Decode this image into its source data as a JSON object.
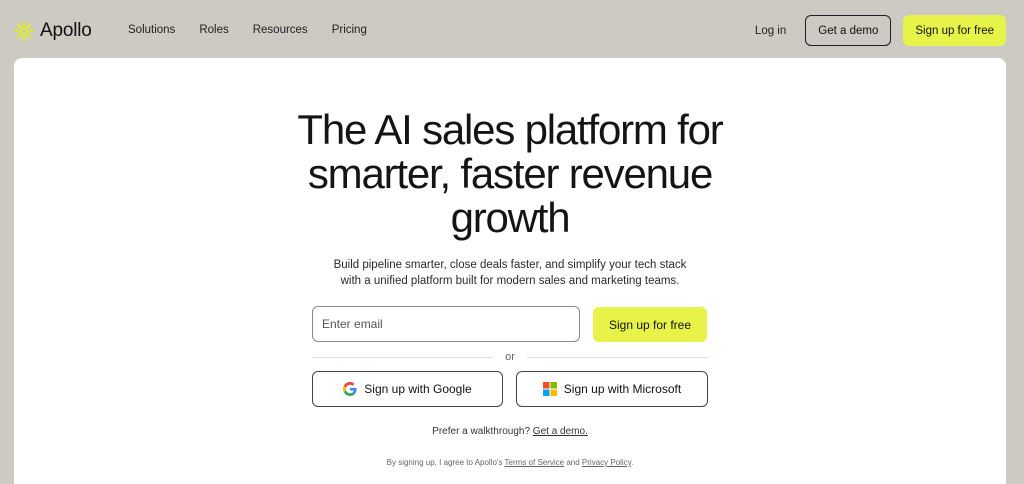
{
  "colors": {
    "page_background": "#cdc9c3",
    "card_background": "#ffffff",
    "accent_yellow": "#e8f34a",
    "logo_yellow": "#dfe93a",
    "text_primary": "#141414"
  },
  "nav": {
    "logo_text": "Apollo",
    "logo_icon": "asterisk-burst-icon",
    "links": [
      "Solutions",
      "Roles",
      "Resources",
      "Pricing"
    ],
    "login": "Log in",
    "demo_button": "Get a demo",
    "signup_button": "Sign up for free"
  },
  "hero": {
    "title_lines": [
      "The AI sales platform for",
      "smarter, faster revenue",
      "growth"
    ],
    "subtitle_lines": [
      "Build pipeline smarter, close deals faster, and simplify your tech stack",
      "with a unified platform built for modern sales and marketing teams."
    ]
  },
  "signup_form": {
    "email_placeholder": "Enter email",
    "email_value": "",
    "submit_button": "Sign up for free",
    "divider_text": "or",
    "google_button": "Sign up with Google",
    "microsoft_button": "Sign up with Microsoft"
  },
  "walkthrough": {
    "prefix": "Prefer a walkthrough? ",
    "link": "Get a demo."
  },
  "legal": {
    "prefix": "By signing up, I agree to Apollo's ",
    "terms_link": "Terms of Service",
    "middle": " and ",
    "privacy_link": "Privacy Policy",
    "suffix": "."
  }
}
